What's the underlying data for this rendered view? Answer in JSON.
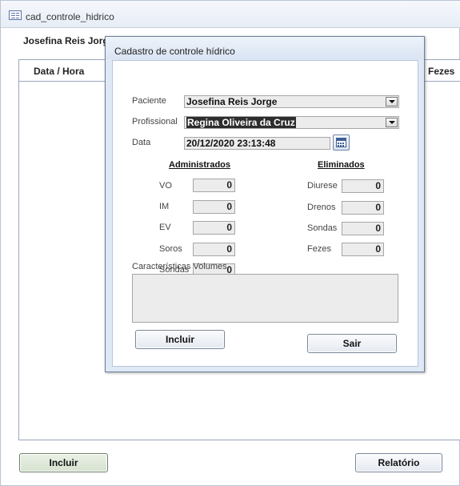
{
  "window": {
    "title": "cad_controle_hidrico",
    "icon": "form-icon"
  },
  "background": {
    "patient_name": "Josefina Reis Jorge",
    "columns": [
      "Data / Hora",
      "Fezes"
    ],
    "buttons": {
      "incluir": "Incluir",
      "relatorio": "Relatório"
    }
  },
  "dialog": {
    "title": "Cadastro de controle hídrico",
    "paciente": {
      "label": "Paciente",
      "value": "Josefina Reis Jorge"
    },
    "profissional": {
      "label": "Profissional",
      "value": "Regina Oliveira da Cruz"
    },
    "data": {
      "label": "Data",
      "value": "20/12/2020 23:13:48"
    },
    "administrados": {
      "title": "Administrados",
      "items": [
        {
          "label": "VO",
          "value": "0"
        },
        {
          "label": "IM",
          "value": "0"
        },
        {
          "label": "EV",
          "value": "0"
        },
        {
          "label": "Soros",
          "value": "0"
        },
        {
          "label": "Sondas",
          "value": "0"
        }
      ]
    },
    "eliminados": {
      "title": "Eliminados",
      "items": [
        {
          "label": "Diurese",
          "value": "0"
        },
        {
          "label": "Drenos",
          "value": "0"
        },
        {
          "label": "Sondas",
          "value": "0"
        },
        {
          "label": "Fezes",
          "value": "0"
        }
      ]
    },
    "caracteristicas_label": "Características Volumes",
    "caracteristicas_value": "",
    "buttons": {
      "incluir": "Incluir",
      "sair": "Sair"
    }
  }
}
